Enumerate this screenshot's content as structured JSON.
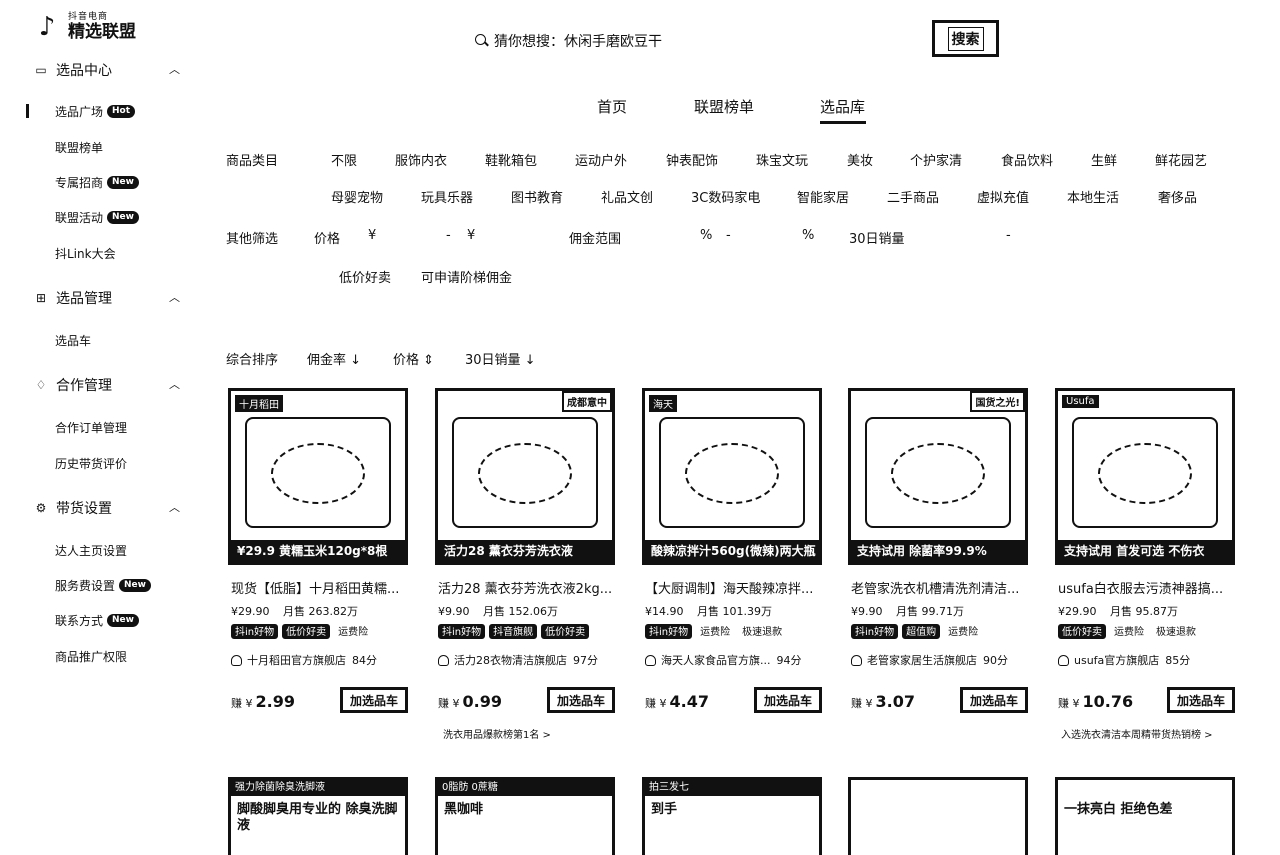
{
  "brand": {
    "top": "抖音电商",
    "main": "精选联盟",
    "icon": "tiktok-note-icon"
  },
  "search": {
    "placeholder": "猜你想搜：休闲手磨欧豆干",
    "button": "搜索"
  },
  "tabs": [
    "首页",
    "联盟榜单",
    "选品库"
  ],
  "active_tab": "选品库",
  "sidebar": {
    "groups": [
      {
        "label": "选品中心",
        "icon": "box-icon",
        "items": [
          {
            "label": "选品广场",
            "badge": "Hot"
          },
          {
            "label": "联盟榜单",
            "badge": ""
          },
          {
            "label": "专属招商",
            "badge": "New"
          },
          {
            "label": "联盟活动",
            "badge": "New"
          },
          {
            "label": "抖Link大会",
            "badge": ""
          }
        ]
      },
      {
        "label": "选品管理",
        "icon": "grid-icon",
        "items": [
          {
            "label": "选品车",
            "badge": ""
          }
        ]
      },
      {
        "label": "合作管理",
        "icon": "handshake-icon",
        "items": [
          {
            "label": "合作订单管理",
            "badge": ""
          },
          {
            "label": "历史带货评价",
            "badge": ""
          }
        ]
      },
      {
        "label": "带货设置",
        "icon": "gear-icon",
        "items": [
          {
            "label": "达人主页设置",
            "badge": ""
          },
          {
            "label": "服务费设置",
            "badge": "New"
          },
          {
            "label": "联系方式",
            "badge": "New"
          },
          {
            "label": "商品推广权限",
            "badge": ""
          }
        ]
      }
    ]
  },
  "filters": {
    "category_label": "商品类目",
    "categories_row1": [
      "不限",
      "服饰内衣",
      "鞋靴箱包",
      "运动户外",
      "钟表配饰",
      "珠宝文玩",
      "美妆",
      "个护家清",
      "食品饮料",
      "生鲜",
      "鲜花园艺"
    ],
    "categories_row2": [
      "母婴宠物",
      "玩具乐器",
      "图书教育",
      "礼品文创",
      "3C数码家电",
      "智能家居",
      "二手商品",
      "虚拟充值",
      "本地生活",
      "奢侈品"
    ],
    "other_label": "其他筛选",
    "price_label": "价格",
    "currency": "¥",
    "dash": "-",
    "commission_label": "佣金范围",
    "percent": "%",
    "sales_label": "30日销量",
    "quick": [
      "低价好卖",
      "可申请阶梯佣金"
    ]
  },
  "sort": [
    "综合排序",
    "佣金率 ↓",
    "价格 ⇕",
    "30日销量 ↓"
  ],
  "products": [
    {
      "title": "现货【低脂】十月稻田黄糯...",
      "price": "¥29.90",
      "sales": "月售 263.82万",
      "tags": [
        "抖in好物",
        "低价好卖",
        "运费险"
      ],
      "shop": "十月稻田官方旗舰店",
      "score": "84分",
      "earn_label": "赚 ¥",
      "earn": "2.99",
      "add": "加选品车",
      "img_top": "十月稻田",
      "img_caption": "¥29.9 黄糯玉米120g*8根",
      "rank": ""
    },
    {
      "title": "活力28 薰衣芬芳洗衣液2kg...",
      "price": "¥9.90",
      "sales": "月售 152.06万",
      "tags": [
        "抖in好物",
        "抖音旗舰",
        "低价好卖"
      ],
      "shop": "活力28衣物清洁旗舰店",
      "score": "97分",
      "earn_label": "赚 ¥",
      "earn": "0.99",
      "add": "加选品车",
      "img_top": "成都意中",
      "img_caption": "活力28 薰衣芬芳洗衣液",
      "rank": "洗衣用品爆款榜第1名 >"
    },
    {
      "title": "【大厨调制】海天酸辣凉拌...",
      "price": "¥14.90",
      "sales": "月售 101.39万",
      "tags": [
        "抖in好物",
        "运费险",
        "极速退款"
      ],
      "shop": "海天人家食品官方旗...",
      "score": "94分",
      "earn_label": "赚 ¥",
      "earn": "4.47",
      "add": "加选品车",
      "img_top": "海天",
      "img_caption": "酸辣凉拌汁560g(微辣)两大瓶",
      "rank": ""
    },
    {
      "title": "老管家洗衣机槽清洗剂清洁...",
      "price": "¥9.90",
      "sales": "月售 99.71万",
      "tags": [
        "抖in好物",
        "超值购",
        "运费险"
      ],
      "shop": "老管家家居生活旗舰店",
      "score": "90分",
      "earn_label": "赚 ¥",
      "earn": "3.07",
      "add": "加选品车",
      "img_top": "国货之光!",
      "img_caption": "支持试用 除菌率99.9%",
      "rank": ""
    },
    {
      "title": "usufa白衣服去污渍神器搞...",
      "price": "¥29.90",
      "sales": "月售 95.87万",
      "tags": [
        "低价好卖",
        "运费险",
        "极速退款"
      ],
      "shop": "usufa官方旗舰店",
      "score": "85分",
      "earn_label": "赚 ¥",
      "earn": "10.76",
      "add": "加选品车",
      "img_top": "Usufa",
      "img_caption": "支持试用 首发可选 不伤衣",
      "rank": "入选洗衣清洁本周精带货热销榜 >"
    }
  ],
  "row2": [
    {
      "head": "强力除菌除臭洗脚液",
      "text": "脚酸脚臭用专业的 除臭洗脚液"
    },
    {
      "head": "0脂肪 0蔗糖",
      "text": "黑咖啡"
    },
    {
      "head": "拍三发七",
      "text": "到手"
    },
    {
      "head": "",
      "text": ""
    },
    {
      "head": "",
      "text": "一抹亮白 拒绝色差"
    }
  ]
}
